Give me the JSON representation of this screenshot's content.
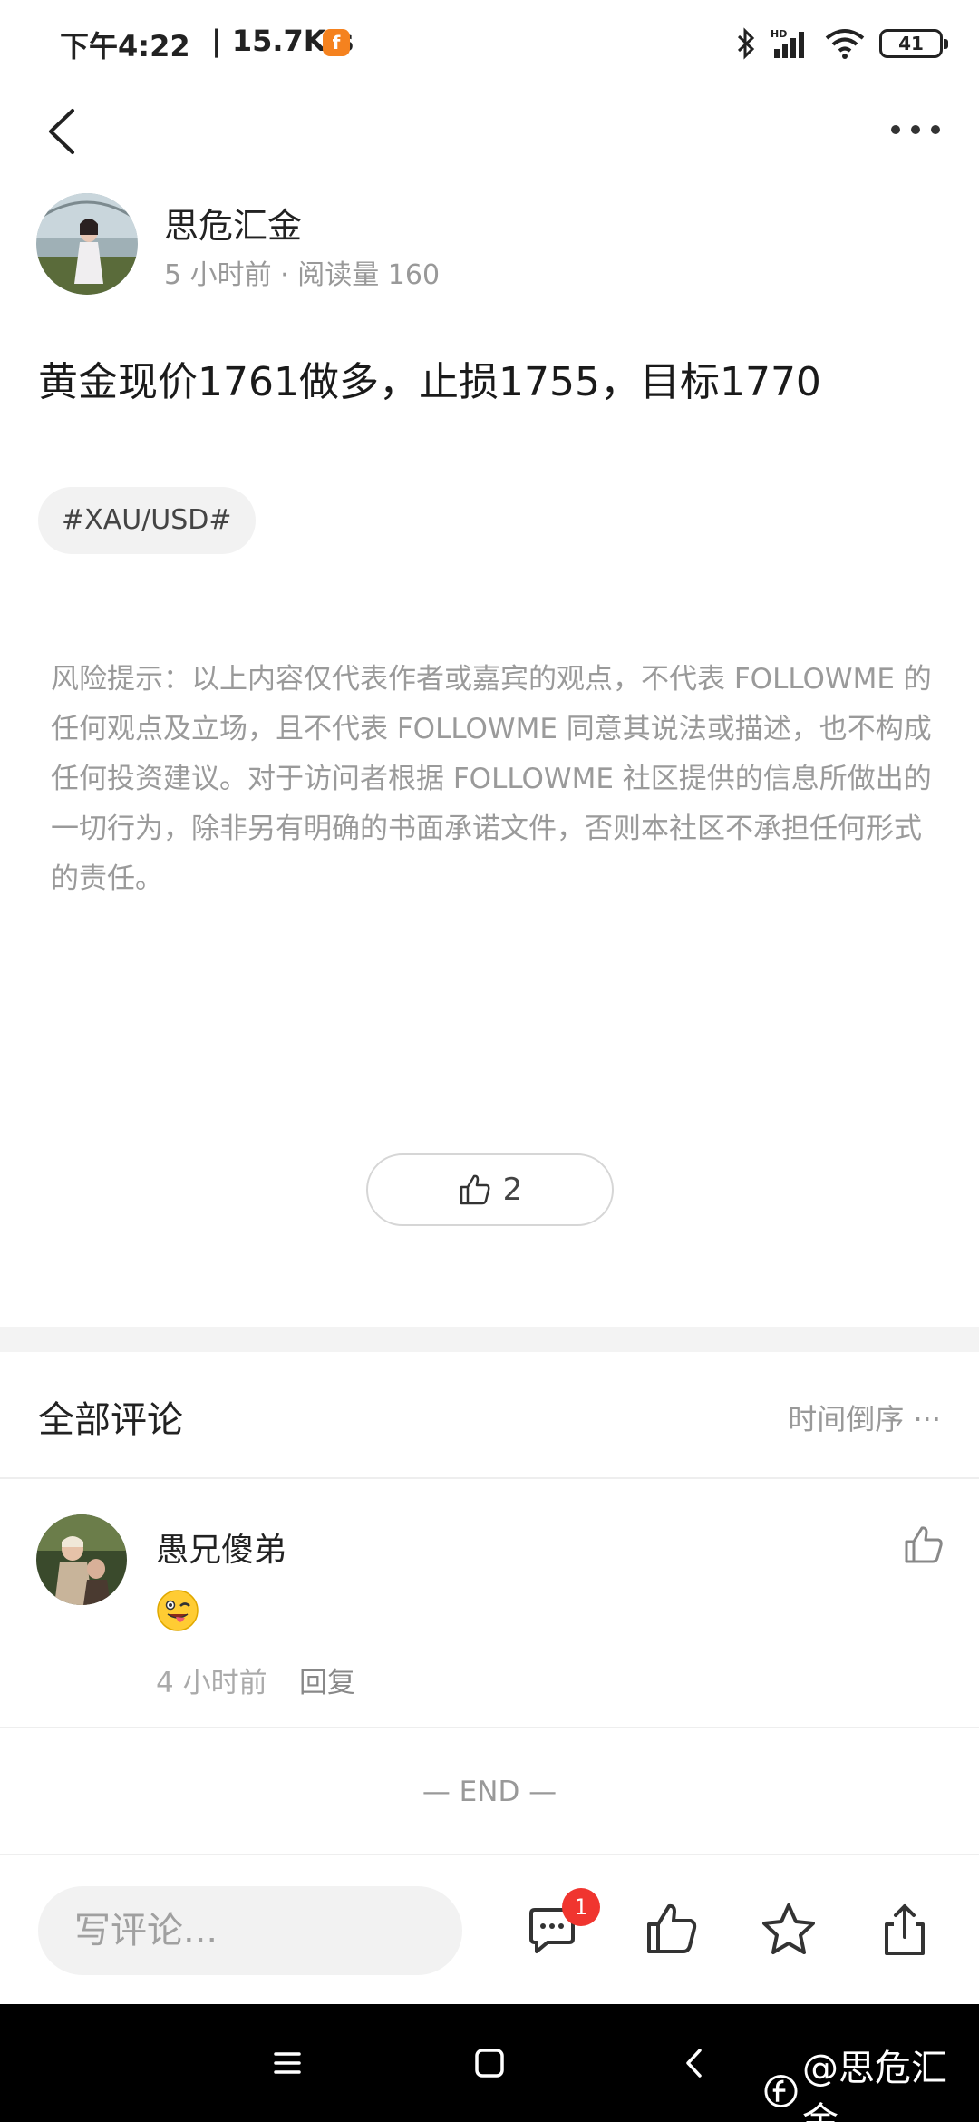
{
  "status_bar": {
    "time": "下午4:22",
    "separator": "|",
    "speed": "15.7K/s",
    "battery": "41",
    "icons": [
      "app-notification-icon",
      "bluetooth-icon",
      "hd-signal-icon",
      "wifi-icon",
      "battery-icon"
    ]
  },
  "header": {
    "back_icon": "back-arrow-icon",
    "more_icon": "more-dots-icon"
  },
  "post": {
    "author": "思危汇金",
    "meta": "5 小时前 · 阅读量 160",
    "content": "黄金现价1761做多，止损1755，目标1770",
    "tag": "#XAU/USD#",
    "disclaimer": "风险提示：以上内容仅代表作者或嘉宾的观点，不代表 FOLLOWME 的任何观点及立场，且不代表 FOLLOWME 同意其说法或描述，也不构成任何投资建议。对于访问者根据 FOLLOWME 社区提供的信息所做出的一切行为，除非另有明确的书面承诺文件，否则本社区不承担任何形式的责任。",
    "like_count": "2"
  },
  "comments": {
    "title": "全部评论",
    "sort_label": "时间倒序",
    "items": [
      {
        "author": "愚兄傻弟",
        "emoji": "winking-face-with-tongue",
        "time": "4 小时前",
        "reply_label": "回复"
      }
    ],
    "end_marker": "— END —"
  },
  "bottom_bar": {
    "input_placeholder": "写评论...",
    "comment_badge": "1",
    "icons": [
      "comment-icon",
      "thumb-up-icon",
      "star-icon",
      "share-icon"
    ]
  },
  "nav_bar": {
    "icons": [
      "menu-icon",
      "home-square-icon",
      "back-icon"
    ],
    "watermark": "@思危汇金"
  },
  "colors": {
    "accent_orange": "#f5821f",
    "badge_red": "#f0352f",
    "text_gray": "#999999"
  }
}
